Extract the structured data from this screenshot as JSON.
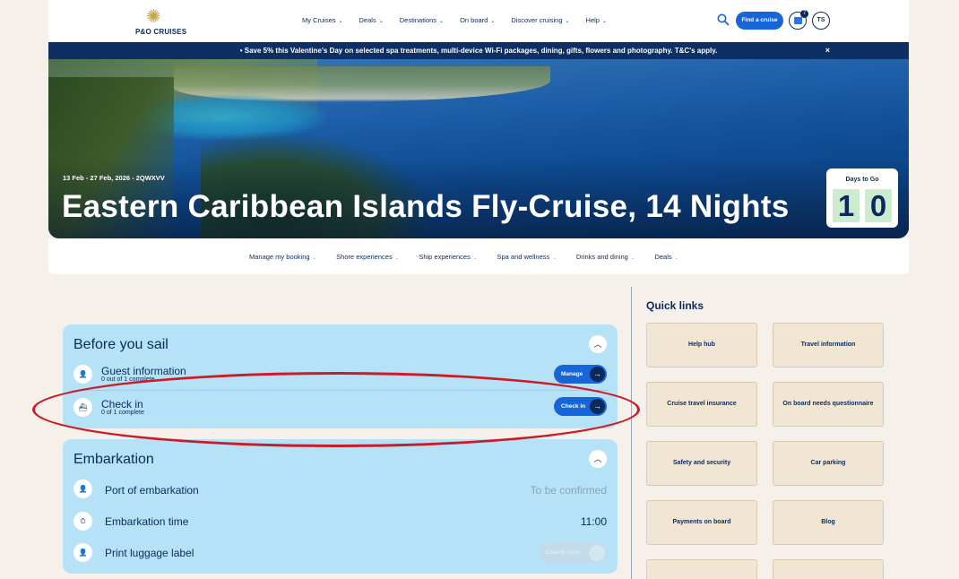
{
  "header": {
    "logo_text": "P&O CRUISES",
    "nav": [
      "My Cruises",
      "Deals",
      "Destinations",
      "On board",
      "Discover cruising",
      "Help"
    ],
    "find_cruise": "Find a cruise",
    "basket_count": "7",
    "avatar_initials": "TS"
  },
  "promo": {
    "text": "• Save 5% this Valentine's Day on selected spa treatments, multi-device Wi-Fi packages, dining, gifts, flowers and photography. T&C's apply.",
    "close": "×"
  },
  "hero": {
    "dates": "13 Feb - 27 Feb, 2026 - 2QWXVV",
    "title": "Eastern Caribbean Islands Fly-Cruise, 14 Nights",
    "countdown_label": "Days to Go",
    "countdown_digits": [
      "1",
      "0"
    ]
  },
  "subnav": [
    "Manage my booking",
    "Shore experiences",
    "Ship experiences",
    "Spa and wellness",
    "Drinks and dining",
    "Deals"
  ],
  "before_you_sail": {
    "title": "Before you sail",
    "rows": [
      {
        "title": "Guest information",
        "sub": "0 out of 1 complete",
        "button": "Manage"
      },
      {
        "title": "Check in",
        "sub": "0 of 1 complete",
        "button": "Check in"
      }
    ]
  },
  "embarkation": {
    "title": "Embarkation",
    "rows": [
      {
        "title": "Port of embarkation",
        "value": "To be confirmed"
      },
      {
        "title": "Embarkation time",
        "value": "11:00"
      },
      {
        "title": "Print luggage label",
        "button": "Coming Soon"
      }
    ]
  },
  "quick_links": {
    "title": "Quick links",
    "items": [
      "Help hub",
      "Travel information",
      "Cruise travel insurance",
      "On board needs questionnaire",
      "Safety and security",
      "Car parking",
      "Payments on board",
      "Blog"
    ]
  }
}
